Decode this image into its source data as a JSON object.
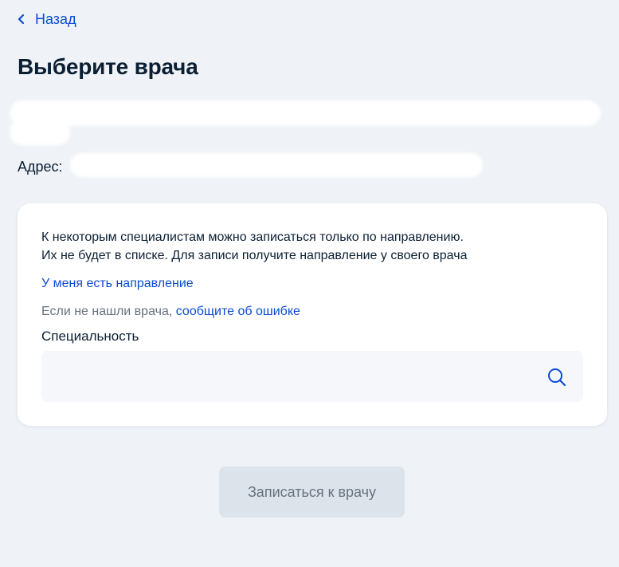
{
  "nav": {
    "back_label": "Назад"
  },
  "page": {
    "title": "Выберите врача",
    "address_label": "Адрес:"
  },
  "card": {
    "notice_line1": "К некоторым специалистам можно записаться только по направлению.",
    "notice_line2": "Их не будет в списке. Для записи получите направление у своего врача",
    "referral_link": "У меня есть направление",
    "error_prefix": "Если не нашли врача, ",
    "error_link": "сообщите об ошибке",
    "specialty_label": "Специальность",
    "specialty_value": ""
  },
  "actions": {
    "submit_label": "Записаться к врачу",
    "submit_enabled": false
  },
  "icons": {
    "back": "chevron-left-icon",
    "search": "search-icon"
  },
  "colors": {
    "link": "#0d4cd3",
    "text": "#0b1f33",
    "muted": "#66727f",
    "background": "#eff2f7",
    "card": "#ffffff",
    "input_bg": "#f5f7fa",
    "button_disabled_bg": "#dde3ea"
  }
}
